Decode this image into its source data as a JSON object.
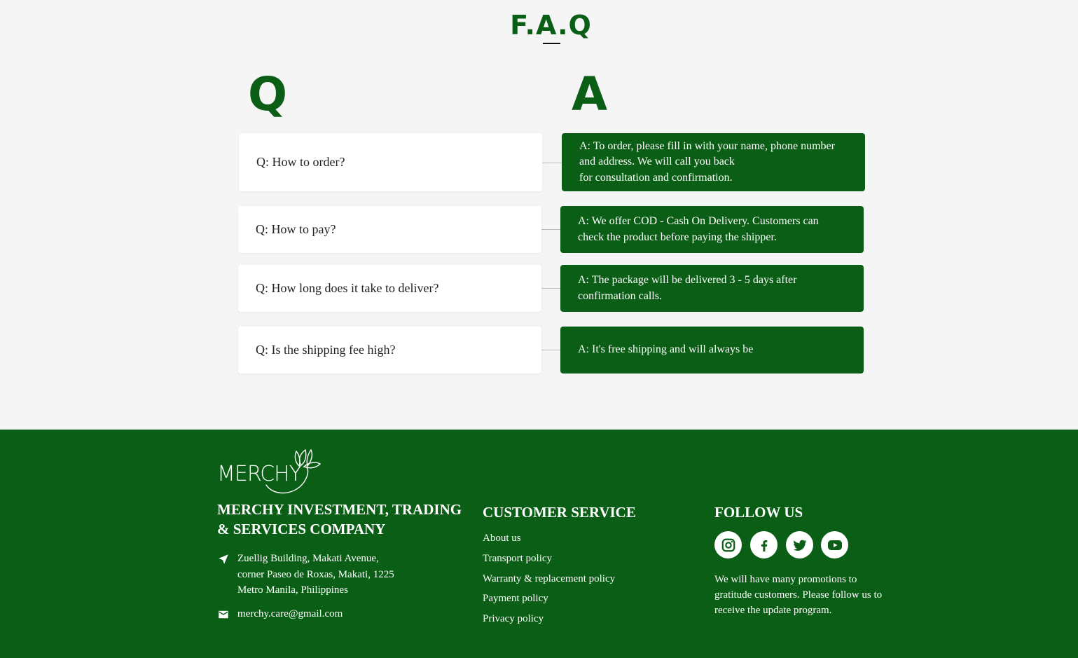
{
  "faq": {
    "title": "F.A.Q",
    "q_heading": "Q",
    "a_heading": "A",
    "items": [
      {
        "q": "Q: How to order?",
        "a": "A: To order, please fill in with your name, phone number\nand address. We will call you back\nfor consultation and confirmation."
      },
      {
        "q": "Q: How to pay?",
        "a": "A: We offer COD - Cash On Delivery. Customers can\ncheck the product before paying the shipper."
      },
      {
        "q": "Q: How long does it take to deliver?",
        "a": "A: The package will be delivered 3 - 5 days after\nconfirmation calls."
      },
      {
        "q": "Q: Is the shipping fee high?",
        "a": "A: It's free shipping and will always be"
      }
    ]
  },
  "footer": {
    "logo_text": "MERCHY",
    "company_name": "MERCHY INVESTMENT, TRADING & SERVICES COMPANY",
    "address": "Zuellig Building, Makati Avenue,\ncorner Paseo de Roxas, Makati, 1225\nMetro Manila, Philippines",
    "email": "merchy.care@gmail.com",
    "customer_service": {
      "heading": "CUSTOMER SERVICE",
      "links": [
        "About us",
        "Transport policy",
        "Warranty & replacement policy",
        "Payment policy",
        "Privacy policy"
      ]
    },
    "follow_us": {
      "heading": "FOLLOW US",
      "socials": [
        "instagram-icon",
        "facebook-icon",
        "twitter-icon",
        "youtube-icon"
      ],
      "text": "We will have many promotions to gratitude customers. Please follow us to receive the update program."
    }
  },
  "colors": {
    "brand_green": "#0b5e15",
    "background": "#f5f5f5",
    "card": "#ffffff"
  }
}
